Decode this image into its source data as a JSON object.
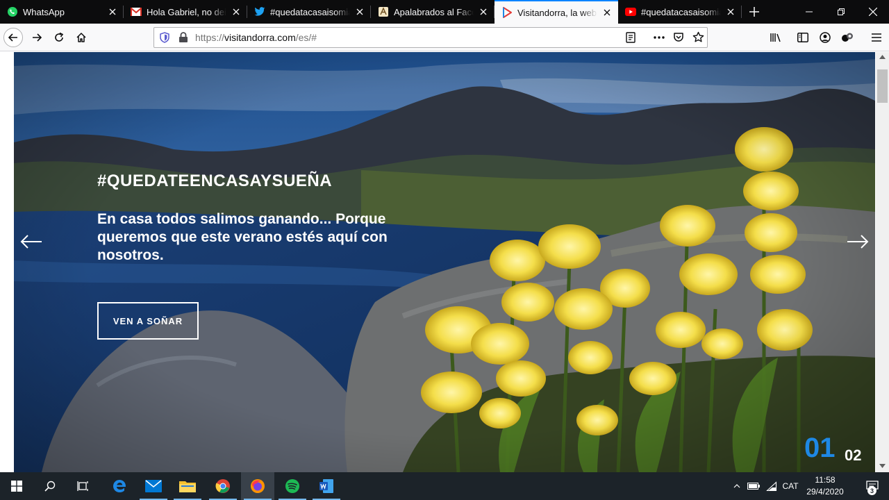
{
  "browser": {
    "tabs": [
      {
        "label": "WhatsApp",
        "icon": "whatsapp-icon",
        "active": false
      },
      {
        "label": "Hola Gabriel, no deixis",
        "icon": "gmail-icon",
        "active": false
      },
      {
        "label": "#quedatacasaisomia - ",
        "icon": "twitter-icon",
        "active": false
      },
      {
        "label": "Apalabrados al Facebo",
        "icon": "apalabrados-icon",
        "active": false
      },
      {
        "label": "Visitandorra, la web of",
        "icon": "visitandorra-icon",
        "active": true
      },
      {
        "label": "#quedatacasaisomia - ",
        "icon": "youtube-icon",
        "active": false
      }
    ],
    "url": {
      "prefix": "https://",
      "host": "visitandorra.com",
      "path": "/es/#"
    }
  },
  "hero": {
    "hashtag": "#QUEDATEENCASAYSUEÑA",
    "subtitle": "En casa todos salimos ganando... Porque queremos que este verano estés aquí con nosotros.",
    "cta": "VEN A SOÑAR",
    "slide_current": "01",
    "slide_total": "02"
  },
  "taskbar": {
    "language": "CAT",
    "time": "11:58",
    "date": "29/4/2020",
    "notifications": "3"
  },
  "colors": {
    "accent": "#0a84ff",
    "slide_current": "#1e88e5",
    "taskbar": "#1c2329"
  }
}
